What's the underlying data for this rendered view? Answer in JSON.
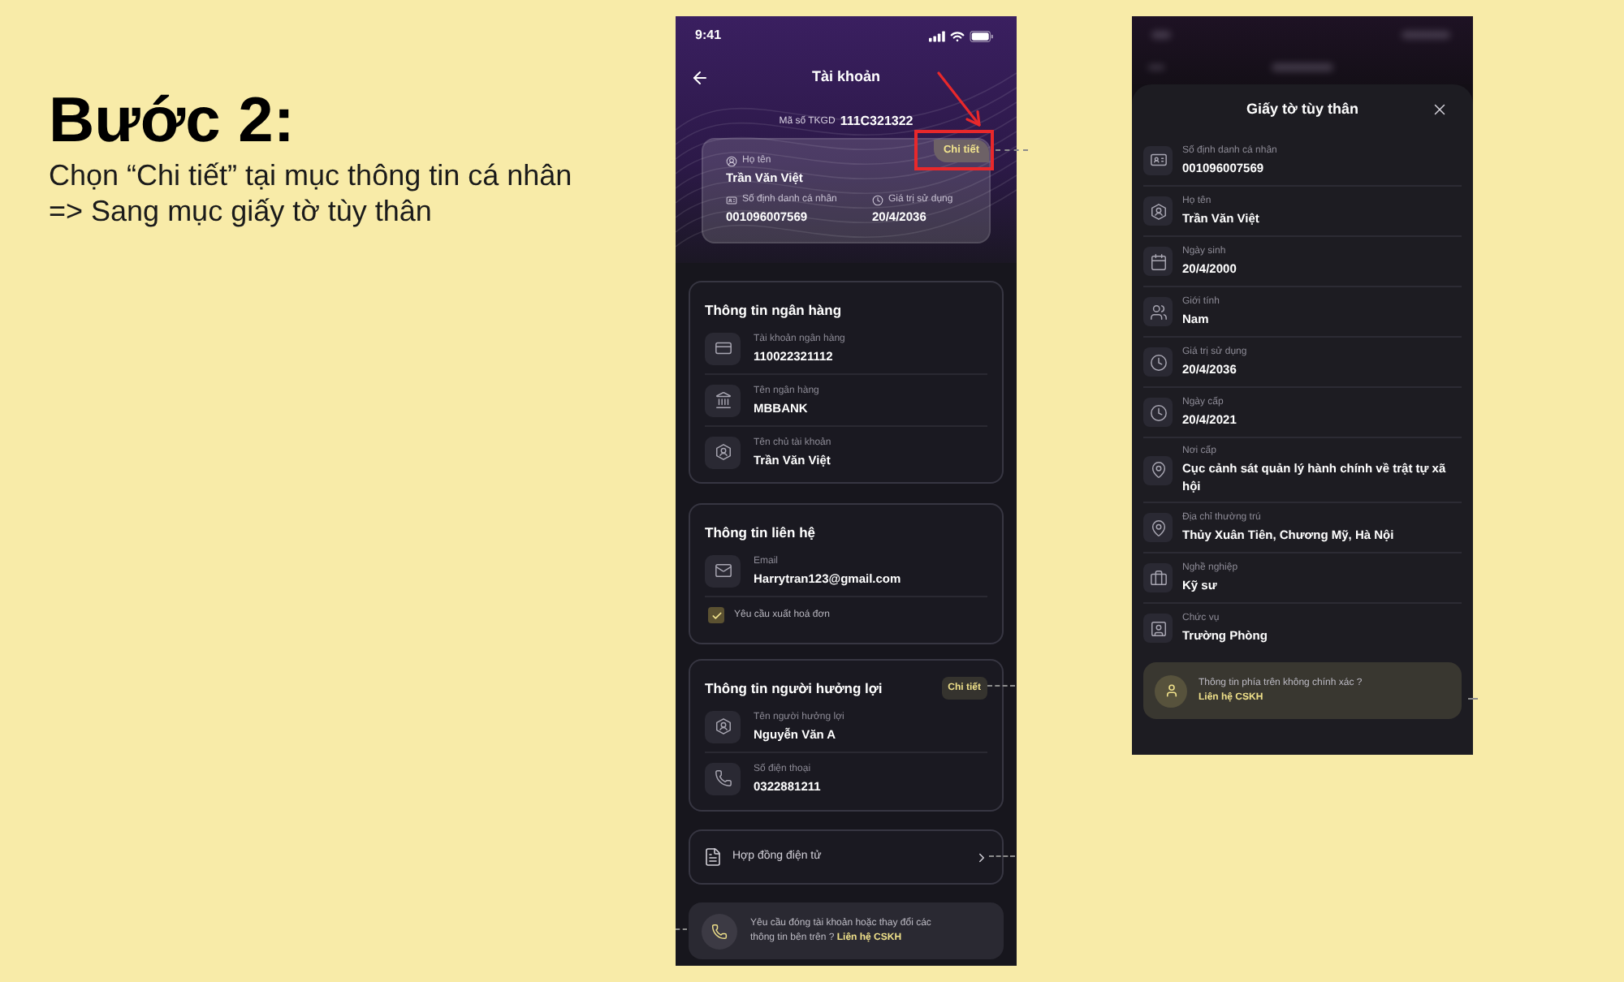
{
  "instruction": {
    "title": "Bước 2:",
    "lines": [
      "Chọn “Chi tiết” tại mục thông tin cá nhân",
      "=> Sang mục giấy tờ tùy thân"
    ]
  },
  "account_screen": {
    "status_bar": {
      "time": "9:41"
    },
    "title": "Tài khoản",
    "transaction_code": {
      "label": "Mã số TKGD",
      "value": "111C321322"
    },
    "identity_card": {
      "detail_button": {
        "label": "Chi tiết",
        "highlighted": true
      },
      "fields": [
        {
          "kind": "name",
          "label": "Họ tên",
          "value": "Trần Văn Việt"
        },
        {
          "kind": "id",
          "label": "Số định danh cá nhân",
          "value": "001096007569"
        },
        {
          "kind": "validity",
          "label": "Giá trị sử dụng",
          "value": "20/4/2036"
        }
      ]
    },
    "sections": [
      {
        "title": "Thông tin ngân hàng",
        "rows": [
          {
            "kind": "account",
            "label": "Tài khoản ngân hàng",
            "value": "110022321112"
          },
          {
            "kind": "bank",
            "label": "Tên ngân hàng",
            "value": "MBBANK"
          },
          {
            "kind": "holder",
            "label": "Tên chủ tài khoản",
            "value": "Trần Văn Việt"
          }
        ]
      },
      {
        "title": "Thông tin liên hệ",
        "rows": [
          {
            "kind": "email",
            "label": "Email",
            "value": "Harrytran123@gmail.com"
          }
        ],
        "checkbox": {
          "label": "Yêu cầu xuất hoá đơn",
          "checked": true
        }
      },
      {
        "title": "Thông tin người hưởng lợi",
        "detail_button": {
          "label": "Chi tiết"
        },
        "rows": [
          {
            "kind": "holder",
            "label": "Tên người hưởng lợi",
            "value": "Nguyễn Văn A"
          },
          {
            "kind": "phone",
            "label": "Số điện thoại",
            "value": "0322881211"
          }
        ]
      }
    ],
    "contract_link": {
      "label": "Hợp đồng điện tử"
    },
    "support": {
      "text": "Yêu cầu đóng tài khoản hoặc thay đổi các thông tin bên trên ?",
      "link": "Liên hệ CSKH"
    }
  },
  "documents_sheet": {
    "title": "Giấy tờ tùy thân",
    "rows": [
      {
        "kind": "id",
        "label": "Số định danh cá nhân",
        "value": "001096007569"
      },
      {
        "kind": "name",
        "label": "Họ tên",
        "value": "Trần Văn Việt"
      },
      {
        "kind": "birth",
        "label": "Ngày sinh",
        "value": "20/4/2000"
      },
      {
        "kind": "gender",
        "label": "Giới tính",
        "value": "Nam"
      },
      {
        "kind": "validity",
        "label": "Giá trị sử dụng",
        "value": "20/4/2036"
      },
      {
        "kind": "issue_date",
        "label": "Ngày cấp",
        "value": "20/4/2021"
      },
      {
        "kind": "place",
        "label": "Nơi cấp",
        "value": "Cục cảnh sát quản lý hành chính về trật tự xã hội"
      },
      {
        "kind": "address",
        "label": "Địa chỉ thường trú",
        "value": "Thủy Xuân Tiên, Chương Mỹ, Hà Nội"
      },
      {
        "kind": "job",
        "label": "Nghề nghiệp",
        "value": "Kỹ sư"
      },
      {
        "kind": "position",
        "label": "Chức vụ",
        "value": "Trường Phòng"
      }
    ],
    "support": {
      "text": "Thông tin phía trên không chính xác ?",
      "link": "Liên hệ CSKH"
    }
  }
}
